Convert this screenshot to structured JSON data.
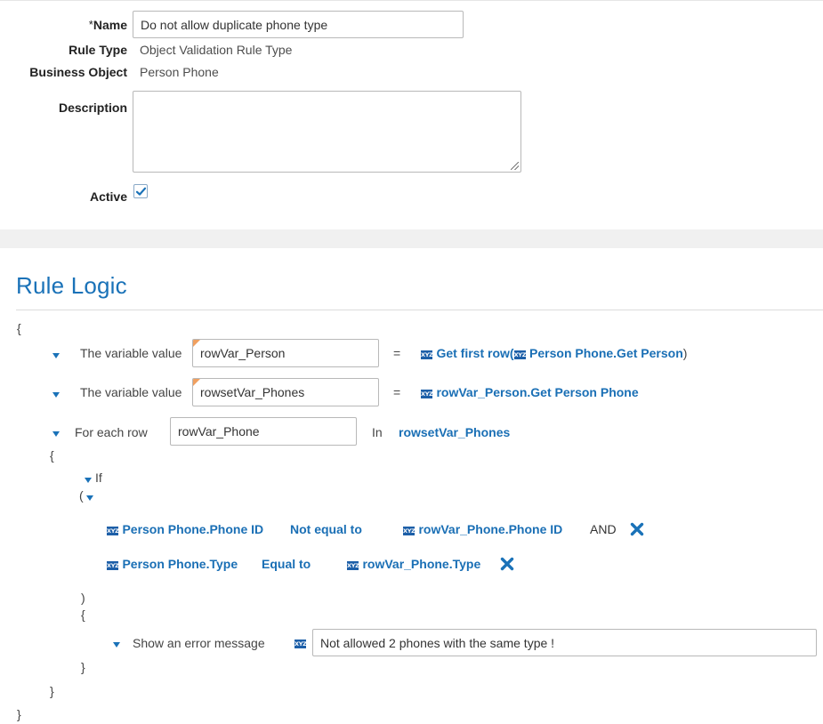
{
  "form": {
    "name_label": "Name",
    "required_mark": "*",
    "name_value": "Do not allow duplicate phone type",
    "rule_type_label": "Rule Type",
    "rule_type_value": "Object Validation Rule Type",
    "business_object_label": "Business Object",
    "business_object_value": "Person Phone",
    "description_label": "Description",
    "description_value": "",
    "active_label": "Active",
    "active_checked": true
  },
  "rule_logic": {
    "title": "Rule Logic",
    "open_brace": "{",
    "close_brace": "}",
    "statements": [
      {
        "prefix": "The variable value",
        "variable": "rowVar_Person",
        "operator": "=",
        "expression_parts": [
          "Get first row(",
          "Person Phone.Get Person",
          ")"
        ]
      },
      {
        "prefix": "The variable value",
        "variable": "rowsetVar_Phones",
        "operator": "=",
        "expression": "rowVar_Person.Get Person Phone"
      }
    ],
    "for_each": {
      "prefix": "For each row",
      "variable": "rowVar_Phone",
      "in_label": "In",
      "collection": "rowsetVar_Phones",
      "open_brace": "{",
      "close_brace": "}",
      "if_block": {
        "label": "If",
        "open_paren": "(",
        "close_paren": ")",
        "open_brace": "{",
        "close_brace": "}",
        "conditions": [
          {
            "left": "Person Phone.Phone ID",
            "operator": "Not equal to",
            "right": "rowVar_Phone.Phone ID",
            "joiner": "AND"
          },
          {
            "left": "Person Phone.Type",
            "operator": "Equal to",
            "right": "rowVar_Phone.Type",
            "joiner": ""
          }
        ],
        "action": {
          "label": "Show an error message",
          "message": "Not allowed 2 phones with the same type !"
        }
      }
    }
  },
  "icons": {
    "expression_badge": "xyz-expression-icon",
    "expand": "caret-down-icon",
    "remove": "close-x-icon",
    "check": "checkmark-icon",
    "xyz_text": "XYZ"
  },
  "colors": {
    "accent": "#1a72b8",
    "link": "#1a6fb5",
    "badge": "#1d5fa8",
    "corner_marker": "#f0a060"
  }
}
